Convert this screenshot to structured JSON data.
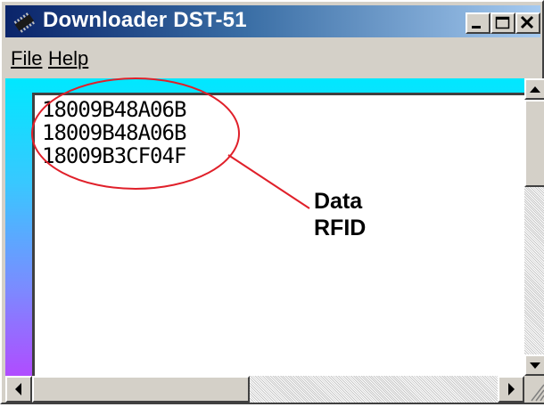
{
  "window": {
    "title": "Downloader DST-51",
    "colors": {
      "titlebar_start": "#0a246a",
      "titlebar_end": "#a6caf0",
      "face": "#d4d0c8",
      "annotation": "#e0202a"
    }
  },
  "menu": {
    "file_label": "File",
    "help_label": "Help"
  },
  "content": {
    "lines": [
      "18009B48A06B",
      "18009B48A06B",
      "18009B3CF04F"
    ]
  },
  "annotation": {
    "line1": "Data",
    "line2": "RFID"
  },
  "icons": {
    "app": "chip-icon",
    "minimize": "minimize-icon",
    "maximize": "maximize-icon",
    "close": "close-icon",
    "scroll_up": "arrow-up-icon",
    "scroll_down": "arrow-down-icon",
    "scroll_left": "arrow-left-icon",
    "scroll_right": "arrow-right-icon"
  }
}
